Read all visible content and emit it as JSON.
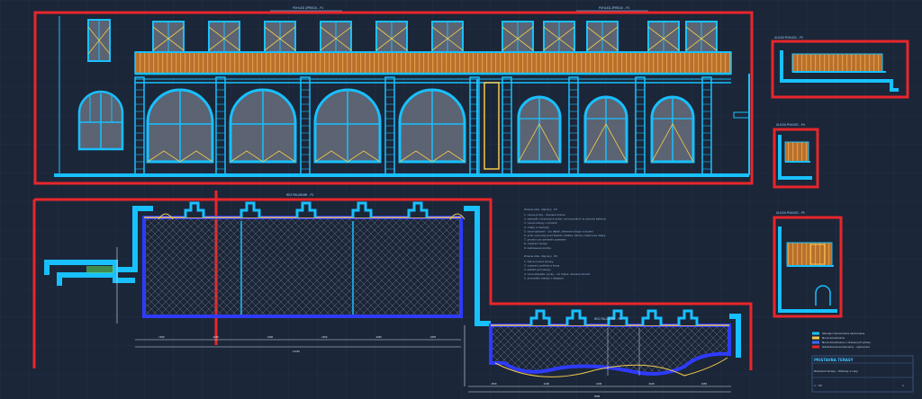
{
  "views": [
    {
      "key": "facade_left",
      "title": "POHLED ZPREDU - P1"
    },
    {
      "key": "facade_right",
      "title": "POHLED ZPREDU - P2"
    },
    {
      "key": "plan_left",
      "title": "REZ PALUBAMI - P1"
    },
    {
      "key": "plan_right",
      "title": "REZ PALUBAMI - P2"
    },
    {
      "key": "section_a",
      "title": "ULICNI POHLED - P3"
    },
    {
      "key": "section_b",
      "title": "ULICNI POHLED - P4"
    },
    {
      "key": "section_c",
      "title": "ULICNI POHLED - P5"
    }
  ],
  "notes": {
    "block1": {
      "heading": "Zmena stav. dopravy - P1",
      "lines": [
        "1. nosne prvky - drevene trame",
        "2. zabradli z drevenych prken na konzolach na obvode balkonu",
        "3. nosne sloupy v prizemi",
        "4. rolety a markyzy",
        "5. nove oplaceni - viz detail, drevene sloupy a kovani",
        "6. prah vysunuty pred fasadu, dlazba, kamen, betonove desky",
        "7. prostor pro zahradni posezeni",
        "8. rozsireni terasy",
        "9. zastresena plocha"
      ]
    },
    "block2": {
      "heading": "Zmena stav. dopravy - P2",
      "lines": [
        "1. hlavni nosne sloupy",
        "2. rozsireni podlahy a teras",
        "3. zaklad pod sloupy",
        "4. nove stavebni prvky - viz rozpis, drevene konstr.",
        "5. provedeni stavby v etapach"
      ]
    }
  },
  "dimensions": {
    "plan_left_chain": [
      "1300",
      "2260",
      "2260",
      "2260",
      "2260",
      "1850"
    ],
    "plan_left_total": "12190",
    "plan_right_chain": [
      "1550",
      "2100",
      "2100",
      "2100",
      "1650"
    ],
    "plan_right_total": "9500"
  },
  "legend": {
    "items": [
      {
        "label": "Stavajici konstrukce  zachovane",
        "color": "#18c0ff"
      },
      {
        "label": "Nove  konstrukce",
        "color": "#f2c94c"
      },
      {
        "label": "Nove konstrukce z drevenych prken",
        "color": "#3c6cff"
      },
      {
        "label": "Odstranene konstrukce - vybourani",
        "color": "#e8262b"
      }
    ]
  },
  "title_block": {
    "project": "PRISTAVBA TERASY",
    "drawing": "Rozsireni terasy - Pohledy a rezy",
    "scale": "1 : 50",
    "sheet": "1"
  },
  "colors": {
    "background": "#1b2638",
    "grid": "#2a3a55",
    "red_frame": "#e8262b",
    "existing": "#18c0ff",
    "new_wood": "#c87f32",
    "window_glass": "#5d6470",
    "new_blue": "#2e3bff",
    "yellow": "#f2c94c",
    "green": "#58d05a"
  }
}
